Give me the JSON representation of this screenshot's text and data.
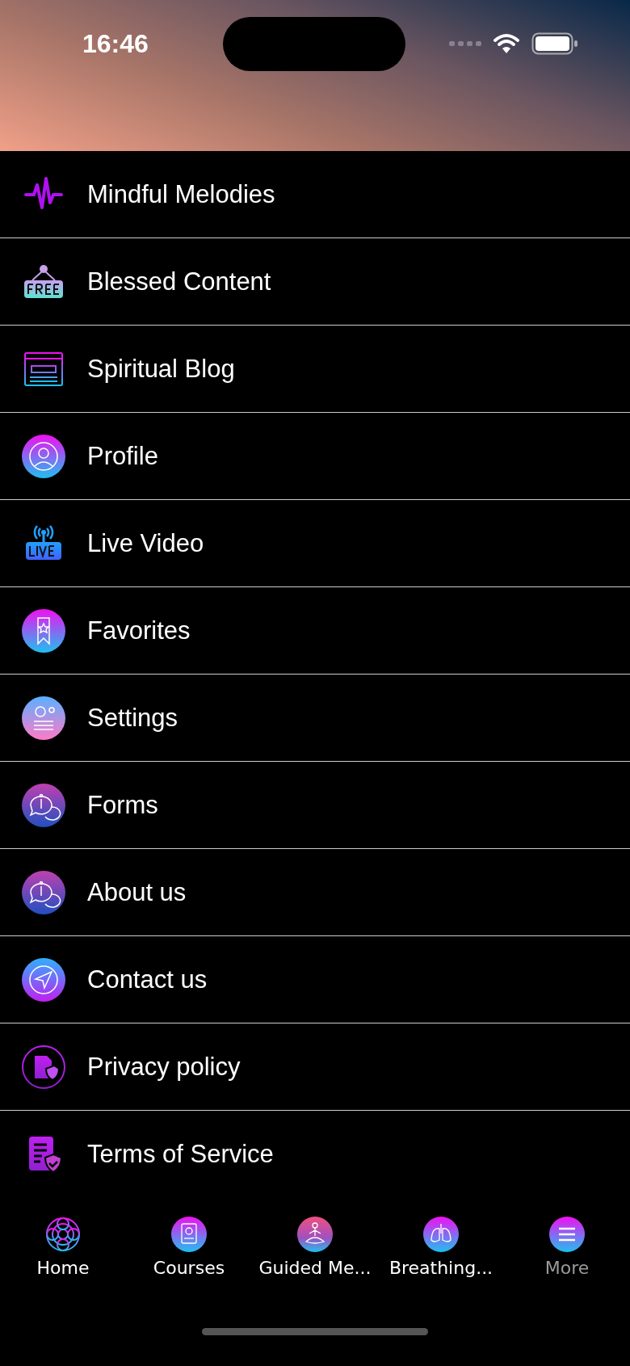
{
  "status_bar": {
    "time": "16:46"
  },
  "menu_items": [
    {
      "label": "Mindful Melodies"
    },
    {
      "label": "Blessed Content"
    },
    {
      "label": "Spiritual Blog"
    },
    {
      "label": "Profile"
    },
    {
      "label": "Live Video"
    },
    {
      "label": "Favorites"
    },
    {
      "label": "Settings"
    },
    {
      "label": "Forms"
    },
    {
      "label": "About us"
    },
    {
      "label": "Contact us"
    },
    {
      "label": "Privacy policy"
    },
    {
      "label": "Terms of Service"
    }
  ],
  "tab_bar": [
    {
      "label": "Home",
      "selected": false
    },
    {
      "label": "Courses",
      "selected": false
    },
    {
      "label": "Guided Me...",
      "selected": false
    },
    {
      "label": "Breathing...",
      "selected": false
    },
    {
      "label": "More",
      "selected": true
    }
  ]
}
